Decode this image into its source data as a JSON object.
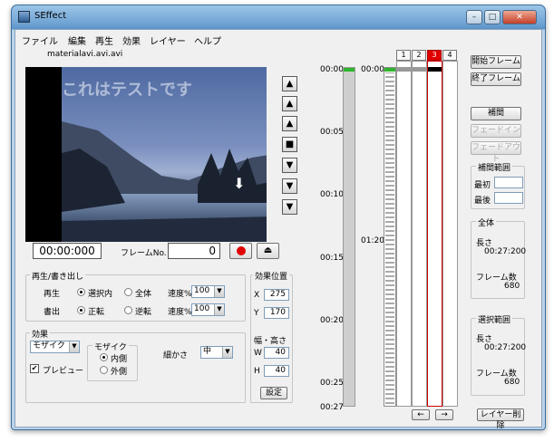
{
  "window": {
    "title": "SEffect",
    "minimize": "–",
    "maximize": "□",
    "close": "✕"
  },
  "menu": [
    "ファイル",
    "編集",
    "再生",
    "効果",
    "レイヤー",
    "ヘルプ"
  ],
  "file_name": "materialavi.avi.avi",
  "video": {
    "overlay_text": "これはテストです"
  },
  "transport": [
    "▲",
    "▲",
    "▲",
    "■",
    "▼",
    "▼",
    "▼"
  ],
  "time_display": "00:00:000",
  "frame_no": {
    "label": "フレームNo.",
    "value": "0"
  },
  "playback": {
    "group_label": "再生/書き出し",
    "play_label": "再生",
    "play_opt1": "選択内",
    "play_opt2": "全体",
    "speed_label": "速度%",
    "play_speed": "100",
    "export_label": "書出",
    "export_opt1": "正転",
    "export_opt2": "逆転",
    "export_speed": "100"
  },
  "effect": {
    "group_label": "効果",
    "type": "モザイク",
    "preview_label": "プレビュー",
    "mosaic_label": "モザイク",
    "inner": "内側",
    "outer": "外側",
    "fineness_label": "細かさ",
    "fineness": "中"
  },
  "position": {
    "group_label": "効果位置",
    "x_label": "X",
    "x": "275",
    "y_label": "Y",
    "y": "170",
    "size_label": "幅・高さ",
    "w_label": "W",
    "w": "40",
    "h_label": "H",
    "h": "40",
    "set_button": "設定"
  },
  "ruler_left": [
    "00:00",
    "00:05",
    "00:10",
    "00:15",
    "00:20",
    "00:25",
    "00:27"
  ],
  "ruler_right": [
    "00:00",
    "01:20"
  ],
  "layers": [
    "1",
    "2",
    "3",
    "4"
  ],
  "nav": {
    "prev": "←",
    "next": "→"
  },
  "right_panel": {
    "start_frame": "開始フレーム",
    "end_frame": "終了フレーム",
    "interp": "補間",
    "fade_in": "フェードイン",
    "fade_out": "フェードアウト",
    "interp_range": "補間範囲",
    "first": "最初",
    "last": "最後",
    "whole": "全体",
    "length_label": "長さ",
    "whole_length": "00:27:200",
    "frames_label": "フレーム数",
    "whole_frames": "680",
    "sel_range": "選択範囲",
    "sel_length": "00:27:200",
    "sel_frames": "680",
    "delete_layer": "レイヤー削除"
  },
  "colors": {
    "accent_red": "#d00000",
    "record": "#e00000"
  }
}
